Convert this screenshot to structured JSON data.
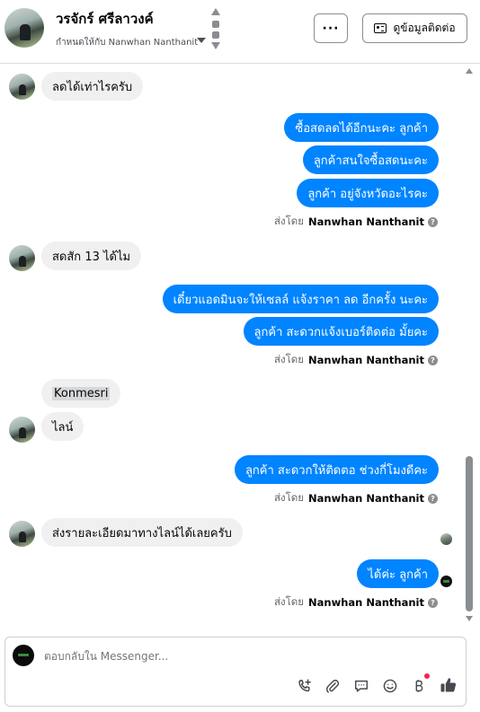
{
  "header": {
    "contact_name": "วรจักร์ ศรีลาวงค์",
    "assigned_text": "กำหนดให้กับ Nanwhan Nanthanit",
    "more_label": "···",
    "contact_info_label": "ดูข้อมูลติดต่อ"
  },
  "messages": [
    {
      "dir": "in",
      "text": "ลดได้เท่าไรครับ"
    },
    {
      "dir": "out",
      "text": "ซื้อสดลดได้อีกนะคะ ลูกค้า"
    },
    {
      "dir": "out",
      "text": "ลูกค้าสนใจซื้อสดนะคะ"
    },
    {
      "dir": "out",
      "text": "ลูกค้า อยู่จังหวัดอะไรคะ"
    },
    {
      "dir": "in",
      "text": "สดสัก 13 ได้ไม"
    },
    {
      "dir": "out",
      "text": "เดี๋ยวแอดมินจะให้เซลล์ แจ้งราคา ลด อีกครั้ง นะคะ"
    },
    {
      "dir": "out",
      "text": "ลูกค้า สะดวกแจ้งเบอร์ติดต่อ มั้ยคะ"
    },
    {
      "dir": "in",
      "text": "Konmesri"
    },
    {
      "dir": "in",
      "text": "ไลน์"
    },
    {
      "dir": "out",
      "text": "ลูกค้า สะดวกให้ติดตอ ช่วงกี่โมงดีคะ"
    },
    {
      "dir": "in",
      "text": "ส่งรายละเอียดมาทางไลน์ได้เลยครับ"
    },
    {
      "dir": "out",
      "text": "ได้ค่ะ ลูกค้า"
    }
  ],
  "sent_by": {
    "prefix": "ส่งโดย",
    "agent_name": "Nanwhan Nanthanit",
    "help_glyph": "?"
  },
  "composer": {
    "placeholder": "ตอบกลับใน Messenger..."
  },
  "icons": [
    "phone-add-icon",
    "paperclip-icon",
    "saved-reply-icon",
    "emoji-icon",
    "baht-icon",
    "thumbs-up-icon"
  ],
  "colors": {
    "outgoing_bubble": "#0084ff",
    "incoming_bubble": "#f0f0f0",
    "notification_dot": "#f02849"
  }
}
